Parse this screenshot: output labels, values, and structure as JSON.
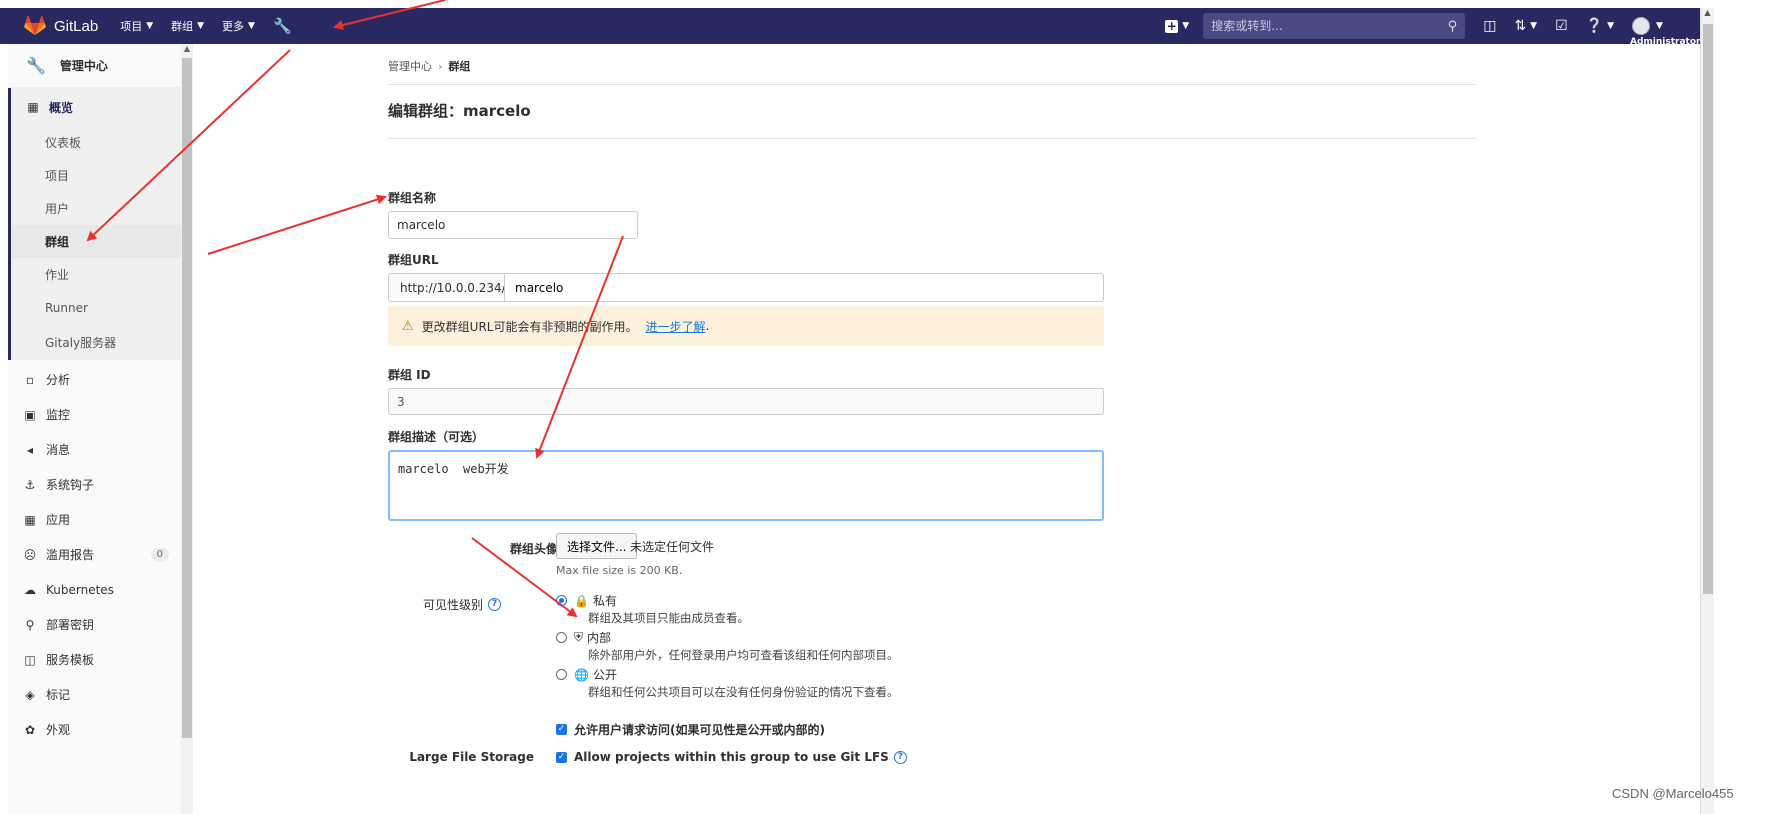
{
  "navbar": {
    "brand": "GitLab",
    "menu": [
      {
        "label": "项目"
      },
      {
        "label": "群组"
      },
      {
        "label": "更多"
      }
    ],
    "search_placeholder": "搜索或转到...",
    "user": "Administrator"
  },
  "sidebar": {
    "header": "管理中心",
    "overview": "概览",
    "overview_items": [
      "仪表板",
      "项目",
      "用户",
      "群组",
      "作业",
      "Runner",
      "Gitaly服务器"
    ],
    "items": [
      {
        "label": "分析",
        "icon": "chart-icon"
      },
      {
        "label": "监控",
        "icon": "monitor-icon"
      },
      {
        "label": "消息",
        "icon": "megaphone-icon"
      },
      {
        "label": "系统钩子",
        "icon": "hook-icon"
      },
      {
        "label": "应用",
        "icon": "apps-icon"
      },
      {
        "label": "滥用报告",
        "icon": "abuse-icon",
        "badge": "0"
      },
      {
        "label": "Kubernetes",
        "icon": "kubernetes-icon"
      },
      {
        "label": "部署密钥",
        "icon": "key-icon"
      },
      {
        "label": "服务模板",
        "icon": "template-icon"
      },
      {
        "label": "标记",
        "icon": "label-icon"
      },
      {
        "label": "外观",
        "icon": "appearance-icon"
      }
    ]
  },
  "breadcrumb": {
    "root": "管理中心",
    "current": "群组"
  },
  "page_title": "编辑群组：marcelo",
  "form": {
    "name_label": "群组名称",
    "name_value": "marcelo",
    "url_label": "群组URL",
    "url_prefix": "http://10.0.0.234/",
    "url_value": "marcelo",
    "warning_text": "更改群组URL可能会有非预期的副作用。",
    "warning_link": "进一步了解",
    "warning_end": ".",
    "id_label": "群组 ID",
    "id_value": "3",
    "desc_label": "群组描述（可选）",
    "desc_value": "marcelo  web开发",
    "avatar_label": "群组头像",
    "file_button": "选择文件...",
    "file_none": "未选定任何文件",
    "file_help": "Max file size is 200 KB.",
    "visibility_label": "可见性级别",
    "visibility": [
      {
        "title": "私有",
        "desc": "群组及其项目只能由成员查看。",
        "selected": true
      },
      {
        "title": "内部",
        "desc": "除外部用户外，任何登录用户均可查看该组和任何内部项目。",
        "selected": false
      },
      {
        "title": "公开",
        "desc": "群组和任何公共项目可以在没有任何身份验证的情况下查看。",
        "selected": false
      }
    ],
    "request_access": "允许用户请求访问(如果可见性是公开或内部的)",
    "lfs_label": "Large File Storage",
    "lfs_check": "Allow projects within this group to use Git LFS"
  },
  "watermark": "CSDN @Marcelo455",
  "colors": {
    "navbar": "#292961",
    "accent": "#1f78d1",
    "arrow": "#e8322e"
  }
}
